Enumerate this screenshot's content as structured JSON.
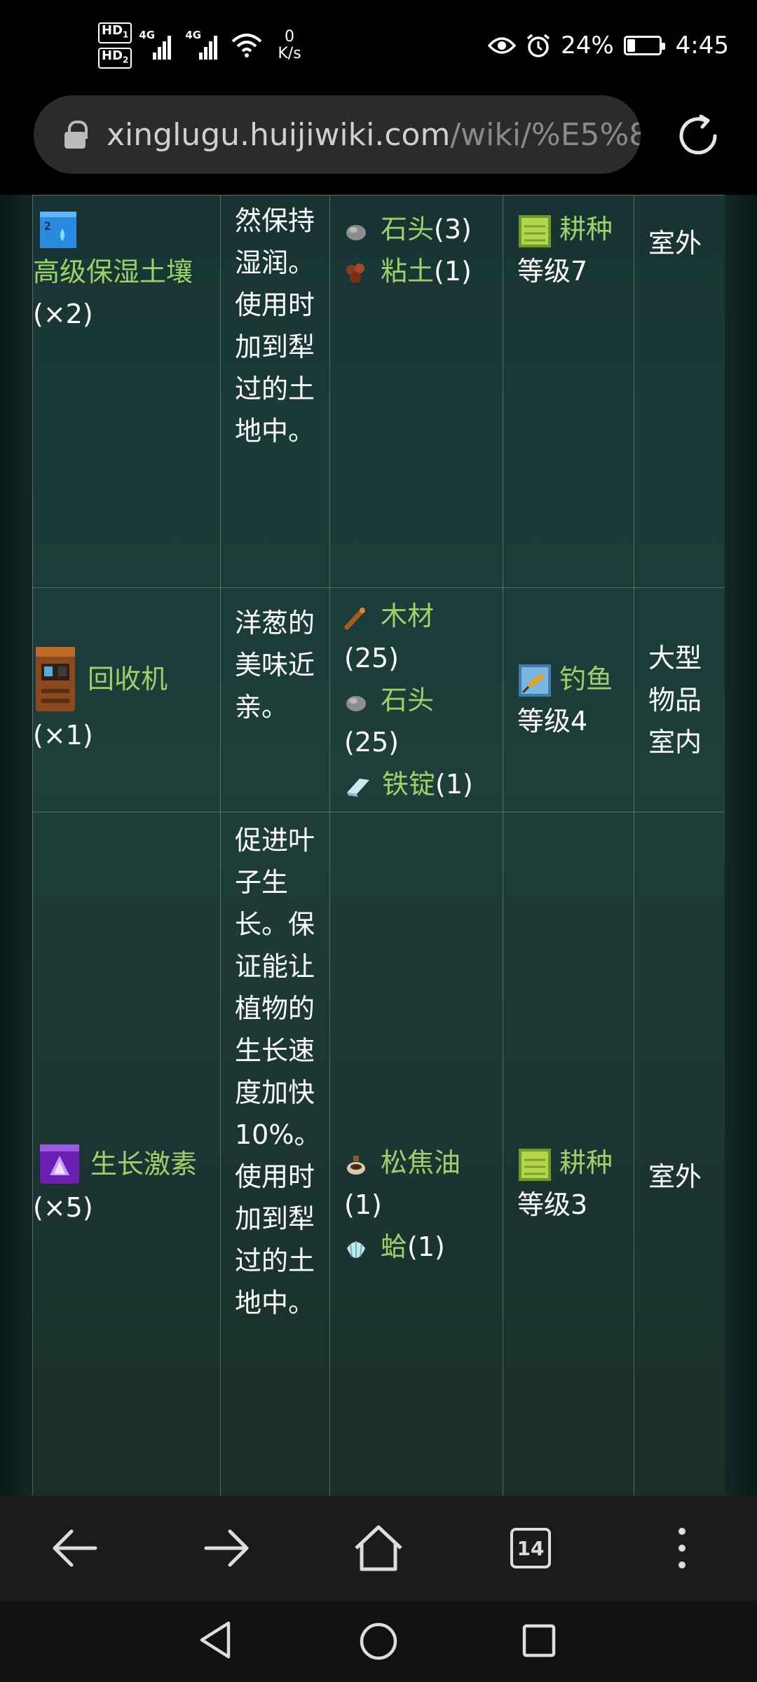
{
  "status_bar": {
    "hd1": "HD",
    "hd1_sub": "1",
    "hd2": "HD",
    "hd2_sub": "2",
    "net1": "4G",
    "net2": "4G",
    "speed_value": "0",
    "speed_unit": "K/s",
    "battery": "24%",
    "battery_level": 0.24,
    "time": "4:45"
  },
  "browser": {
    "url_host": "xinglugu.huijiwiki.com",
    "url_path": "/wiki/%E5%8",
    "tab_count": "14"
  },
  "rows": [
    {
      "item_name": "高级保湿土壤",
      "item_qty": "(×2)",
      "icon": "deluxe-retaining-soil-icon",
      "description": "然保持湿润。使用时加到犁过的土地中。",
      "ingredients": [
        {
          "name": "石头",
          "qty": "(3)",
          "icon": "stone-icon"
        },
        {
          "name": "粘土",
          "qty": "(1)",
          "icon": "clay-icon"
        }
      ],
      "skill": {
        "name": "耕种",
        "level": "等级7",
        "icon": "farming-skill-icon"
      },
      "location": "室外"
    },
    {
      "item_name": "回收机",
      "item_qty": "(×1)",
      "icon": "recycling-machine-icon",
      "description": "洋葱的美味近亲。",
      "ingredients": [
        {
          "name": "木材",
          "qty": "(25)",
          "icon": "wood-icon"
        },
        {
          "name": "石头",
          "qty": "(25)",
          "icon": "stone-icon"
        },
        {
          "name": "铁锭",
          "qty": "(1)",
          "icon": "iron-bar-icon"
        }
      ],
      "skill": {
        "name": "钓鱼",
        "level": "等级4",
        "icon": "fishing-skill-icon"
      },
      "location": "大型物品室内"
    },
    {
      "item_name": "生长激素",
      "item_qty": "(×5)",
      "icon": "speed-gro-icon",
      "description": "促进叶子生长。保证能让植物的生长速度加快10%。使用时加到犁过的土地中。",
      "ingredients": [
        {
          "name": "松焦油",
          "qty": "(1)",
          "icon": "pine-tar-icon"
        },
        {
          "name": "蛤",
          "qty": "(1)",
          "icon": "clam-icon"
        }
      ],
      "skill": {
        "name": "耕种",
        "level": "等级3",
        "icon": "farming-skill-icon"
      },
      "location": "室外"
    }
  ]
}
